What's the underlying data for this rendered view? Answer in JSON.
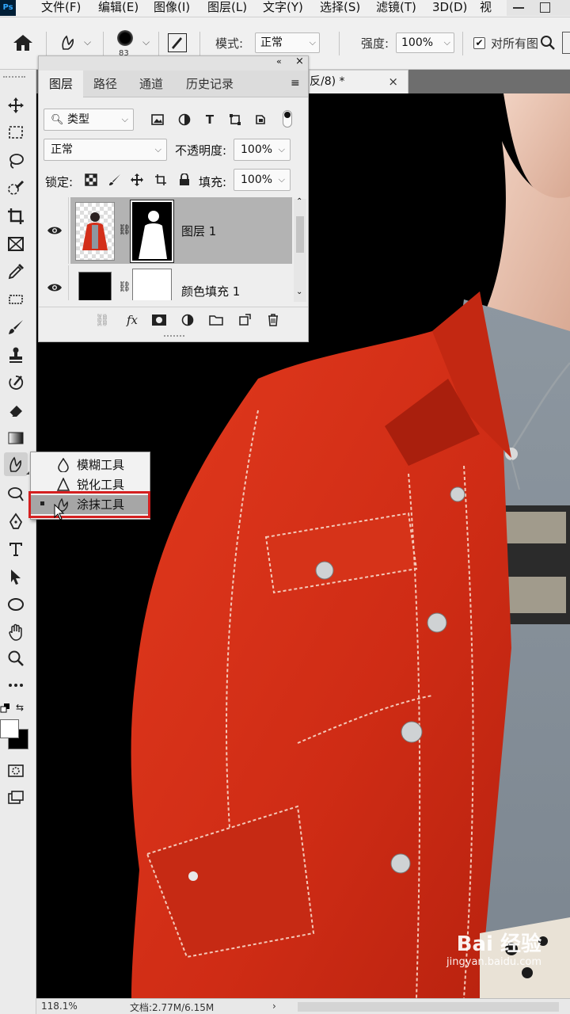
{
  "menubar": {
    "logo": "Ps",
    "items": [
      "文件(F)",
      "编辑(E)",
      "图像(I)",
      "图层(L)",
      "文字(Y)",
      "选择(S)",
      "滤镜(T)",
      "3D(D)",
      "视"
    ]
  },
  "options": {
    "brush_size": "83",
    "mode_label": "模式:",
    "mode_value": "正常",
    "strength_label": "强度:",
    "strength_value": "100%",
    "sample_all_label": "对所有图",
    "sample_all_checked": true
  },
  "document": {
    "tab_title": "反/8) *",
    "close": "×"
  },
  "layers_panel": {
    "tabs": [
      "图层",
      "路径",
      "通道",
      "历史记录"
    ],
    "filter_label": "类型",
    "blend_mode": "正常",
    "opacity_label": "不透明度:",
    "opacity_value": "100%",
    "lock_label": "锁定:",
    "fill_label": "填充:",
    "fill_value": "100%",
    "layers": [
      {
        "name": "图层 1",
        "selected": true
      },
      {
        "name": "颜色填充 1",
        "selected": false
      }
    ]
  },
  "flyout": {
    "items": [
      {
        "label": "模糊工具",
        "icon": "blur-drop-icon"
      },
      {
        "label": "锐化工具",
        "icon": "sharpen-triangle-icon"
      },
      {
        "label": "涂抹工具",
        "icon": "smudge-finger-icon",
        "selected": true
      }
    ]
  },
  "statusbar": {
    "zoom": "118.1%",
    "doc": "文档:2.77M/6.15M"
  },
  "watermark": {
    "brand": "Bai 经验",
    "url": "jingyan.baidu.com"
  },
  "colors": {
    "highlight_red": "#d42020",
    "jacket_red": "#d8321a"
  }
}
